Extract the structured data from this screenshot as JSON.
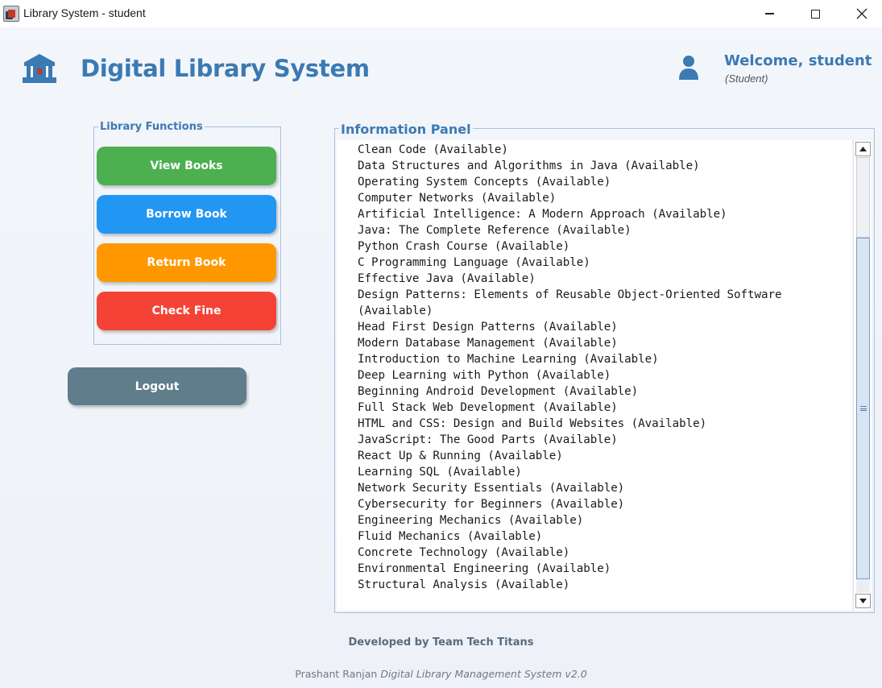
{
  "window": {
    "title": "Library System - student",
    "controls": [
      "minimize",
      "maximize",
      "close"
    ]
  },
  "header": {
    "app_title": "Digital Library System",
    "logo_icon": "library-building-icon",
    "user_icon": "user-icon",
    "welcome": "Welcome, student",
    "role": "(Student)"
  },
  "functions": {
    "group_title": "Library Functions",
    "view_books": "View Books",
    "borrow_book": "Borrow Book",
    "return_book": "Return Book",
    "check_fine": "Check Fine",
    "logout": "Logout"
  },
  "colors": {
    "accent": "#3b7ab3",
    "view_books": "#4caf50",
    "borrow_book": "#2196f3",
    "return_book": "#ff9800",
    "check_fine": "#f44336",
    "logout": "#607d8b"
  },
  "info_panel": {
    "title": "Information Panel",
    "lines": [
      "Clean Code (Available)",
      "Data Structures and Algorithms in Java (Available)",
      "Operating System Concepts (Available)",
      "Computer Networks (Available)",
      "Artificial Intelligence: A Modern Approach (Available)",
      "Java: The Complete Reference (Available)",
      "Python Crash Course (Available)",
      "C Programming Language (Available)",
      "Effective Java (Available)",
      "Design Patterns: Elements of Reusable Object-Oriented Software",
      "(Available)",
      "Head First Design Patterns (Available)",
      "Modern Database Management (Available)",
      "Introduction to Machine Learning (Available)",
      "Deep Learning with Python (Available)",
      "Beginning Android Development (Available)",
      "Full Stack Web Development (Available)",
      "HTML and CSS: Design and Build Websites (Available)",
      "JavaScript: The Good Parts (Available)",
      "React Up & Running (Available)",
      "Learning SQL (Available)",
      "Network Security Essentials (Available)",
      "Cybersecurity for Beginners (Available)",
      "Engineering Mechanics (Available)",
      "Fluid Mechanics (Available)",
      "Concrete Technology (Available)",
      "Environmental Engineering (Available)",
      "Structural Analysis (Available)"
    ]
  },
  "footer": {
    "developed_by": "Developed by Team Tech Titans",
    "author": "Prashant Ranjan",
    "product": "Digital Library Management System v2.0"
  }
}
